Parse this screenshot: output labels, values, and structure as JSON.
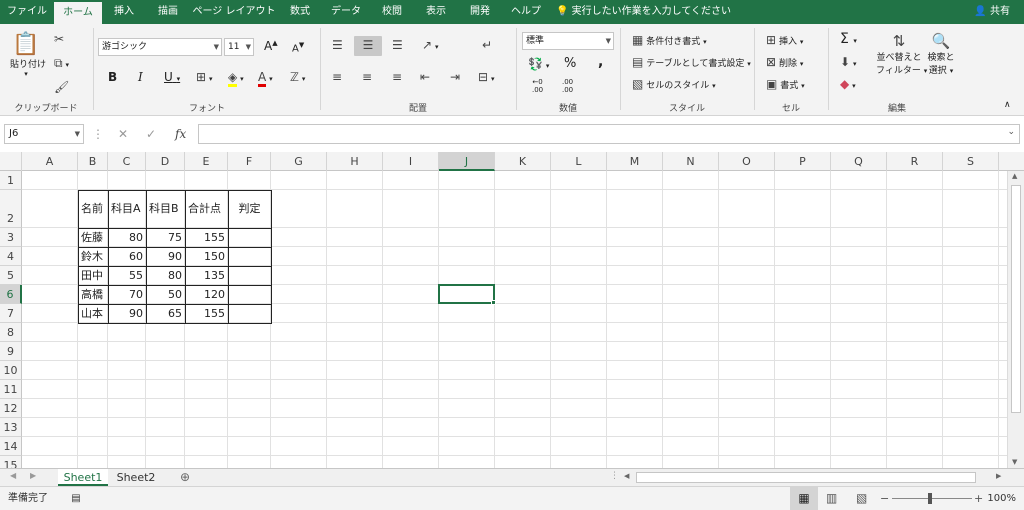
{
  "tabs": [
    "ファイル",
    "ホーム",
    "挿入",
    "描画",
    "ページ レイアウト",
    "数式",
    "データ",
    "校閲",
    "表示",
    "開発",
    "ヘルプ"
  ],
  "active_tab": "ホーム",
  "tell_me": "実行したい作業を入力してください",
  "share": "共有",
  "ribbon": {
    "clipboard": {
      "paste": "貼り付け",
      "label": "クリップボード"
    },
    "font": {
      "name": "游ゴシック",
      "size": "11",
      "bold": "B",
      "italic": "I",
      "underline": "U",
      "font_color": "A",
      "label": "フォント",
      "grow": "A",
      "shrink": "A"
    },
    "alignment": {
      "label": "配置"
    },
    "number": {
      "format": "標準",
      "percent": "%",
      "comma": ",",
      "label": "数値",
      "inc": ".00",
      "dec": ".00"
    },
    "styles": {
      "conditional": "条件付き書式",
      "table": "テーブルとして書式設定",
      "cell": "セルのスタイル",
      "label": "スタイル"
    },
    "cells": {
      "insert": "挿入",
      "delete": "削除",
      "format": "書式",
      "label": "セル"
    },
    "editing": {
      "sum": "Σ",
      "sort": "並べ替えと",
      "sort2": "フィルター",
      "find": "検索と",
      "find2": "選択",
      "label": "編集"
    }
  },
  "namebox": "J6",
  "fx": "fx",
  "columns": [
    "A",
    "B",
    "C",
    "D",
    "E",
    "F",
    "G",
    "H",
    "I",
    "J",
    "K",
    "L",
    "M",
    "N",
    "O",
    "P",
    "Q",
    "R",
    "S"
  ],
  "rows": [
    "1",
    "2",
    "3",
    "4",
    "5",
    "6",
    "7",
    "8",
    "9",
    "10",
    "11",
    "12",
    "13",
    "14",
    "15"
  ],
  "selected_col": "J",
  "selected_row": "6",
  "table": {
    "headers": [
      "名前",
      "科目A",
      "科目B",
      "合計点",
      "判定"
    ],
    "rows": [
      [
        "佐藤",
        "80",
        "75",
        "155",
        ""
      ],
      [
        "鈴木",
        "60",
        "90",
        "150",
        ""
      ],
      [
        "田中",
        "55",
        "80",
        "135",
        ""
      ],
      [
        "高橋",
        "70",
        "50",
        "120",
        ""
      ],
      [
        "山本",
        "90",
        "65",
        "155",
        ""
      ]
    ]
  },
  "sheets": [
    "Sheet1",
    "Sheet2"
  ],
  "active_sheet": "Sheet1",
  "status": "準備完了",
  "zoom": "100%",
  "colors": {
    "brand": "#217346"
  }
}
